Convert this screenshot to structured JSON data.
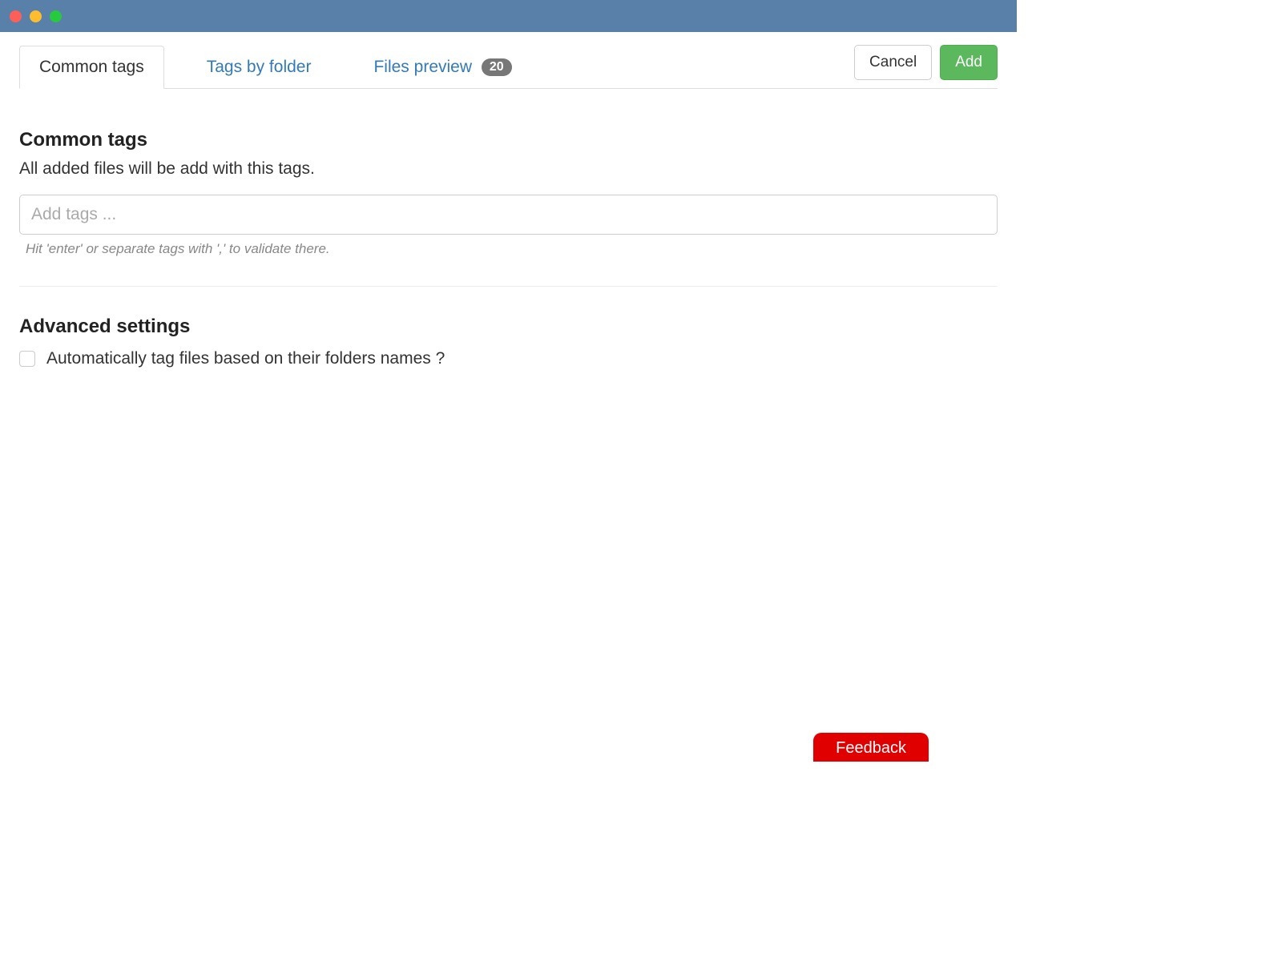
{
  "tabs": {
    "common_tags": "Common tags",
    "tags_by_folder": "Tags by folder",
    "files_preview": "Files preview",
    "files_preview_count": "20"
  },
  "actions": {
    "cancel": "Cancel",
    "add": "Add"
  },
  "common_tags_section": {
    "title": "Common tags",
    "description": "All added files will be add with this tags.",
    "input_placeholder": "Add tags ...",
    "hint": "Hit 'enter' or separate tags with ',' to validate there."
  },
  "advanced_settings": {
    "title": "Advanced settings",
    "checkbox_label": "Automatically tag files based on their folders names ?"
  },
  "feedback": {
    "label": "Feedback"
  }
}
